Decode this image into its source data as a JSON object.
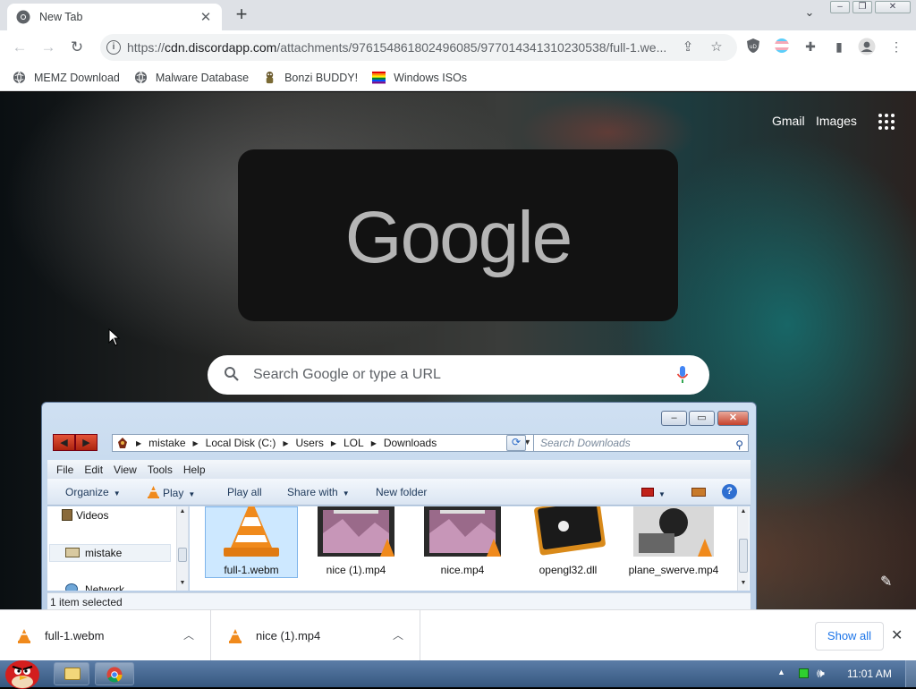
{
  "browser": {
    "tab_title": "New Tab",
    "url_prefix": "https://",
    "url_host": "cdn.discordapp.com",
    "url_path": "/attachments/976154861802496085/977014341310230538/full-1.we...",
    "bookmarks": [
      {
        "label": "MEMZ Download",
        "icon": "globe-icon"
      },
      {
        "label": "Malware Database",
        "icon": "globe-icon"
      },
      {
        "label": "Bonzi BUDDY!",
        "icon": "bonzi-icon"
      },
      {
        "label": "Windows ISOs",
        "icon": "windows-flag-icon"
      }
    ]
  },
  "newtab": {
    "gmail": "Gmail",
    "images": "Images",
    "logo": "Google",
    "search_placeholder": "Search Google or type a URL"
  },
  "explorer": {
    "breadcrumb": [
      "mistake",
      "Local Disk (C:)",
      "Users",
      "LOL",
      "Downloads"
    ],
    "search_placeholder": "Search Downloads",
    "menu": [
      "File",
      "Edit",
      "View",
      "Tools",
      "Help"
    ],
    "commands": {
      "organize": "Organize",
      "play": "Play",
      "play_all": "Play all",
      "share_with": "Share with",
      "new_folder": "New folder"
    },
    "nav_items": [
      "Videos",
      "mistake",
      "Network"
    ],
    "files": [
      {
        "name": "full-1.webm",
        "icon": "vlc-cone-icon",
        "selected": true
      },
      {
        "name": "nice (1).mp4",
        "icon": "video-thumbnail-icon",
        "selected": false
      },
      {
        "name": "nice.mp4",
        "icon": "video-thumbnail-icon",
        "selected": false
      },
      {
        "name": "opengl32.dll",
        "icon": "dll-file-icon",
        "selected": false
      },
      {
        "name": "plane_swerve.mp4",
        "icon": "video-thumbnail-icon",
        "selected": false
      }
    ],
    "status": "1 item selected"
  },
  "downloads": {
    "items": [
      "full-1.webm",
      "nice (1).mp4"
    ],
    "show_all": "Show all"
  },
  "taskbar": {
    "clock": "11:01 AM"
  },
  "colors": {
    "vlc_orange": "#f08a1c",
    "link_blue": "#1a73e8",
    "taskbar": "#4a6b93"
  }
}
